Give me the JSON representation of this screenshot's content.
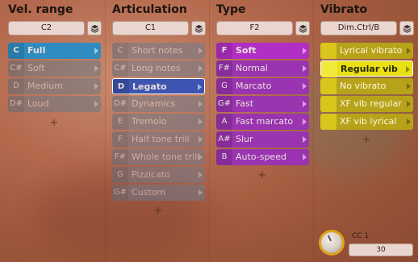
{
  "columns": [
    {
      "title": "Vel. range",
      "selector": "C2",
      "items": [
        {
          "tag": "C",
          "label": "Full",
          "state": "active"
        },
        {
          "tag": "C#",
          "label": "Soft",
          "state": "dim"
        },
        {
          "tag": "D",
          "label": "Medium",
          "state": "dim"
        },
        {
          "tag": "D#",
          "label": "Loud",
          "state": "dim"
        }
      ],
      "colors": {
        "active": "#2f8bc0",
        "dim": "#6a7987"
      }
    },
    {
      "title": "Articulation",
      "selector": "C1",
      "items": [
        {
          "tag": "C",
          "label": "Short notes",
          "state": "dim"
        },
        {
          "tag": "C#",
          "label": "Long notes",
          "state": "dim"
        },
        {
          "tag": "D",
          "label": "Legato",
          "state": "selected"
        },
        {
          "tag": "D#",
          "label": "Dynamics",
          "state": "dim"
        },
        {
          "tag": "E",
          "label": "Tremolo",
          "state": "dim"
        },
        {
          "tag": "F",
          "label": "Half tone trill",
          "state": "dim"
        },
        {
          "tag": "F#",
          "label": "Whole tone trill",
          "state": "dim"
        },
        {
          "tag": "G",
          "label": "Pizzicato",
          "state": "dim"
        },
        {
          "tag": "G#",
          "label": "Custom",
          "state": "dim"
        }
      ],
      "colors": {
        "selected": "#3d54b0",
        "dim": "#6f7b8e"
      }
    },
    {
      "title": "Type",
      "selector": "F2",
      "items": [
        {
          "tag": "F",
          "label": "Soft",
          "state": "active"
        },
        {
          "tag": "F#",
          "label": "Normal",
          "state": "normal"
        },
        {
          "tag": "G",
          "label": "Marcato",
          "state": "normal"
        },
        {
          "tag": "G#",
          "label": "Fast",
          "state": "normal"
        },
        {
          "tag": "A",
          "label": "Fast marcato",
          "state": "normal"
        },
        {
          "tag": "A#",
          "label": "Slur",
          "state": "normal"
        },
        {
          "tag": "B",
          "label": "Auto-speed",
          "state": "normal"
        }
      ],
      "colors": {
        "active": "#b12fc4",
        "normal": "#9a34b0"
      }
    },
    {
      "title": "Vibrato",
      "selector": "Dim.Ctrl/B",
      "items": [
        {
          "tag": "",
          "label": "Lyrical vibrato",
          "state": "normal"
        },
        {
          "tag": "",
          "label": "Regular vib",
          "state": "selected"
        },
        {
          "tag": "",
          "label": "No vibrato",
          "state": "normal"
        },
        {
          "tag": "",
          "label": "XF vib regular",
          "state": "normal"
        },
        {
          "tag": "",
          "label": "XF vib lyrical",
          "state": "normal"
        }
      ],
      "colors": {
        "selected": "#e8df14",
        "normal": "#b7a31a"
      }
    }
  ],
  "cc_control": {
    "label": "CC 1",
    "value": "30"
  }
}
